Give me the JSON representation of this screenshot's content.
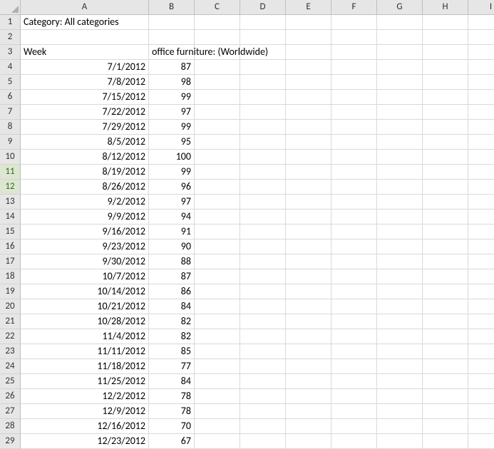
{
  "columns": [
    "A",
    "B",
    "C",
    "D",
    "E",
    "F",
    "G",
    "H",
    "I"
  ],
  "rowCount": 29,
  "highlightRows": [
    11,
    12
  ],
  "cells": {
    "A1": {
      "text": "Category: All categories",
      "align": "l",
      "overflow": true
    },
    "A3": {
      "text": "Week",
      "align": "l"
    },
    "B3": {
      "text": "office furniture: (Worldwide)",
      "align": "l",
      "overflow": true
    },
    "A4": {
      "text": "7/1/2012",
      "align": "r"
    },
    "B4": {
      "text": "87",
      "align": "r"
    },
    "A5": {
      "text": "7/8/2012",
      "align": "r"
    },
    "B5": {
      "text": "98",
      "align": "r"
    },
    "A6": {
      "text": "7/15/2012",
      "align": "r"
    },
    "B6": {
      "text": "99",
      "align": "r"
    },
    "A7": {
      "text": "7/22/2012",
      "align": "r"
    },
    "B7": {
      "text": "97",
      "align": "r"
    },
    "A8": {
      "text": "7/29/2012",
      "align": "r"
    },
    "B8": {
      "text": "99",
      "align": "r"
    },
    "A9": {
      "text": "8/5/2012",
      "align": "r"
    },
    "B9": {
      "text": "95",
      "align": "r"
    },
    "A10": {
      "text": "8/12/2012",
      "align": "r"
    },
    "B10": {
      "text": "100",
      "align": "r"
    },
    "A11": {
      "text": "8/19/2012",
      "align": "r"
    },
    "B11": {
      "text": "99",
      "align": "r"
    },
    "A12": {
      "text": "8/26/2012",
      "align": "r"
    },
    "B12": {
      "text": "96",
      "align": "r"
    },
    "A13": {
      "text": "9/2/2012",
      "align": "r"
    },
    "B13": {
      "text": "97",
      "align": "r"
    },
    "A14": {
      "text": "9/9/2012",
      "align": "r"
    },
    "B14": {
      "text": "94",
      "align": "r"
    },
    "A15": {
      "text": "9/16/2012",
      "align": "r"
    },
    "B15": {
      "text": "91",
      "align": "r"
    },
    "A16": {
      "text": "9/23/2012",
      "align": "r"
    },
    "B16": {
      "text": "90",
      "align": "r"
    },
    "A17": {
      "text": "9/30/2012",
      "align": "r"
    },
    "B17": {
      "text": "88",
      "align": "r"
    },
    "A18": {
      "text": "10/7/2012",
      "align": "r"
    },
    "B18": {
      "text": "87",
      "align": "r"
    },
    "A19": {
      "text": "10/14/2012",
      "align": "r"
    },
    "B19": {
      "text": "86",
      "align": "r"
    },
    "A20": {
      "text": "10/21/2012",
      "align": "r"
    },
    "B20": {
      "text": "84",
      "align": "r"
    },
    "A21": {
      "text": "10/28/2012",
      "align": "r"
    },
    "B21": {
      "text": "82",
      "align": "r"
    },
    "A22": {
      "text": "11/4/2012",
      "align": "r"
    },
    "B22": {
      "text": "82",
      "align": "r"
    },
    "A23": {
      "text": "11/11/2012",
      "align": "r"
    },
    "B23": {
      "text": "85",
      "align": "r"
    },
    "A24": {
      "text": "11/18/2012",
      "align": "r"
    },
    "B24": {
      "text": "77",
      "align": "r"
    },
    "A25": {
      "text": "11/25/2012",
      "align": "r"
    },
    "B25": {
      "text": "84",
      "align": "r"
    },
    "A26": {
      "text": "12/2/2012",
      "align": "r"
    },
    "B26": {
      "text": "78",
      "align": "r"
    },
    "A27": {
      "text": "12/9/2012",
      "align": "r"
    },
    "B27": {
      "text": "78",
      "align": "r"
    },
    "A28": {
      "text": "12/16/2012",
      "align": "r"
    },
    "B28": {
      "text": "70",
      "align": "r"
    },
    "A29": {
      "text": "12/23/2012",
      "align": "r"
    },
    "B29": {
      "text": "67",
      "align": "r"
    }
  }
}
